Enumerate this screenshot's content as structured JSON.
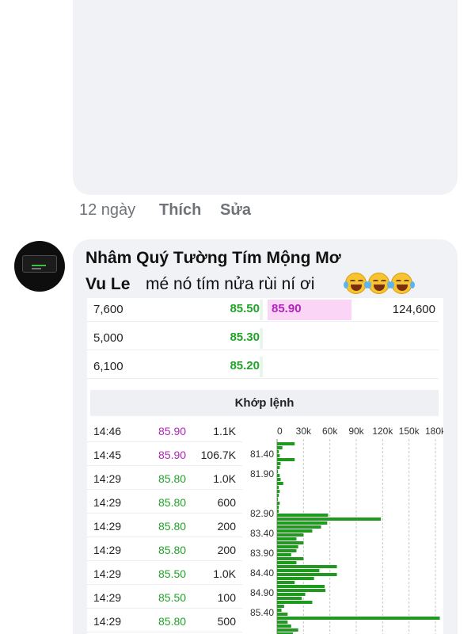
{
  "previous_comment": {
    "time": "12 ngày",
    "like_label": "Thích",
    "edit_label": "Sửa"
  },
  "comment": {
    "author": "Nhâm Quý Tường Tím Mộng Mơ",
    "mention": "Vu Le",
    "text": "mé nó tím nửa rùi ní ơi",
    "emoji": "face-with-tears-of-joy-icon",
    "emoji_count": 3
  },
  "order_book": [
    {
      "bid_volume": "7,600",
      "bid_price": "85.50",
      "ask_price": "85.90",
      "ask_volume": "124,600"
    },
    {
      "bid_volume": "5,000",
      "bid_price": "85.30",
      "ask_price": "",
      "ask_volume": ""
    },
    {
      "bid_volume": "6,100",
      "bid_price": "85.20",
      "ask_price": "",
      "ask_volume": ""
    }
  ],
  "matched_section_title": "Khớp lệnh",
  "matched_orders": [
    {
      "time": "14:46",
      "price": "85.90",
      "volume": "1.1K",
      "color": "#b026b8"
    },
    {
      "time": "14:45",
      "price": "85.90",
      "volume": "106.7K",
      "color": "#b026b8"
    },
    {
      "time": "14:29",
      "price": "85.80",
      "volume": "1.0K",
      "color": "#22a32a"
    },
    {
      "time": "14:29",
      "price": "85.80",
      "volume": "600",
      "color": "#22a32a"
    },
    {
      "time": "14:29",
      "price": "85.80",
      "volume": "200",
      "color": "#22a32a"
    },
    {
      "time": "14:29",
      "price": "85.80",
      "volume": "200",
      "color": "#22a32a"
    },
    {
      "time": "14:29",
      "price": "85.50",
      "volume": "1.0K",
      "color": "#22a32a"
    },
    {
      "time": "14:29",
      "price": "85.50",
      "volume": "100",
      "color": "#22a32a"
    },
    {
      "time": "14:29",
      "price": "85.80",
      "volume": "500",
      "color": "#22a32a"
    }
  ],
  "colors": {
    "up_green": "#22a32a",
    "ceiling_purple": "#b026b8",
    "bar_green": "#1f9a1f",
    "bubble_bg": "#f0f2f5"
  },
  "chart_data": {
    "type": "bar",
    "orientation": "horizontal",
    "x_ticks": [
      "0",
      "30k",
      "60k",
      "90k",
      "120k",
      "150k",
      "180k"
    ],
    "xlim": [
      0,
      180000
    ],
    "y_tick_labels": [
      "81.40",
      "81.90",
      "82.90",
      "83.40",
      "83.90",
      "84.40",
      "84.90",
      "85.40"
    ],
    "y_tick_values": [
      81.4,
      81.9,
      82.9,
      83.4,
      83.9,
      84.4,
      84.9,
      85.4
    ],
    "price_step": 0.1,
    "y_start": 81.1,
    "values": [
      20000,
      6000,
      2000,
      3000,
      20000,
      4000,
      3000,
      1000,
      3000,
      4000,
      7000,
      2000,
      3000,
      2000,
      1000,
      3000,
      2000,
      2000,
      58000,
      118000,
      57000,
      50000,
      40000,
      30000,
      22000,
      30000,
      24000,
      22000,
      16000,
      30000,
      22000,
      68000,
      48000,
      68000,
      42000,
      20000,
      54000,
      55000,
      32000,
      28000,
      40000,
      8000,
      5000,
      12000,
      185000,
      12000,
      16000,
      24000,
      18000,
      10000
    ],
    "grid": true,
    "title": "",
    "xlabel": "",
    "ylabel": ""
  }
}
